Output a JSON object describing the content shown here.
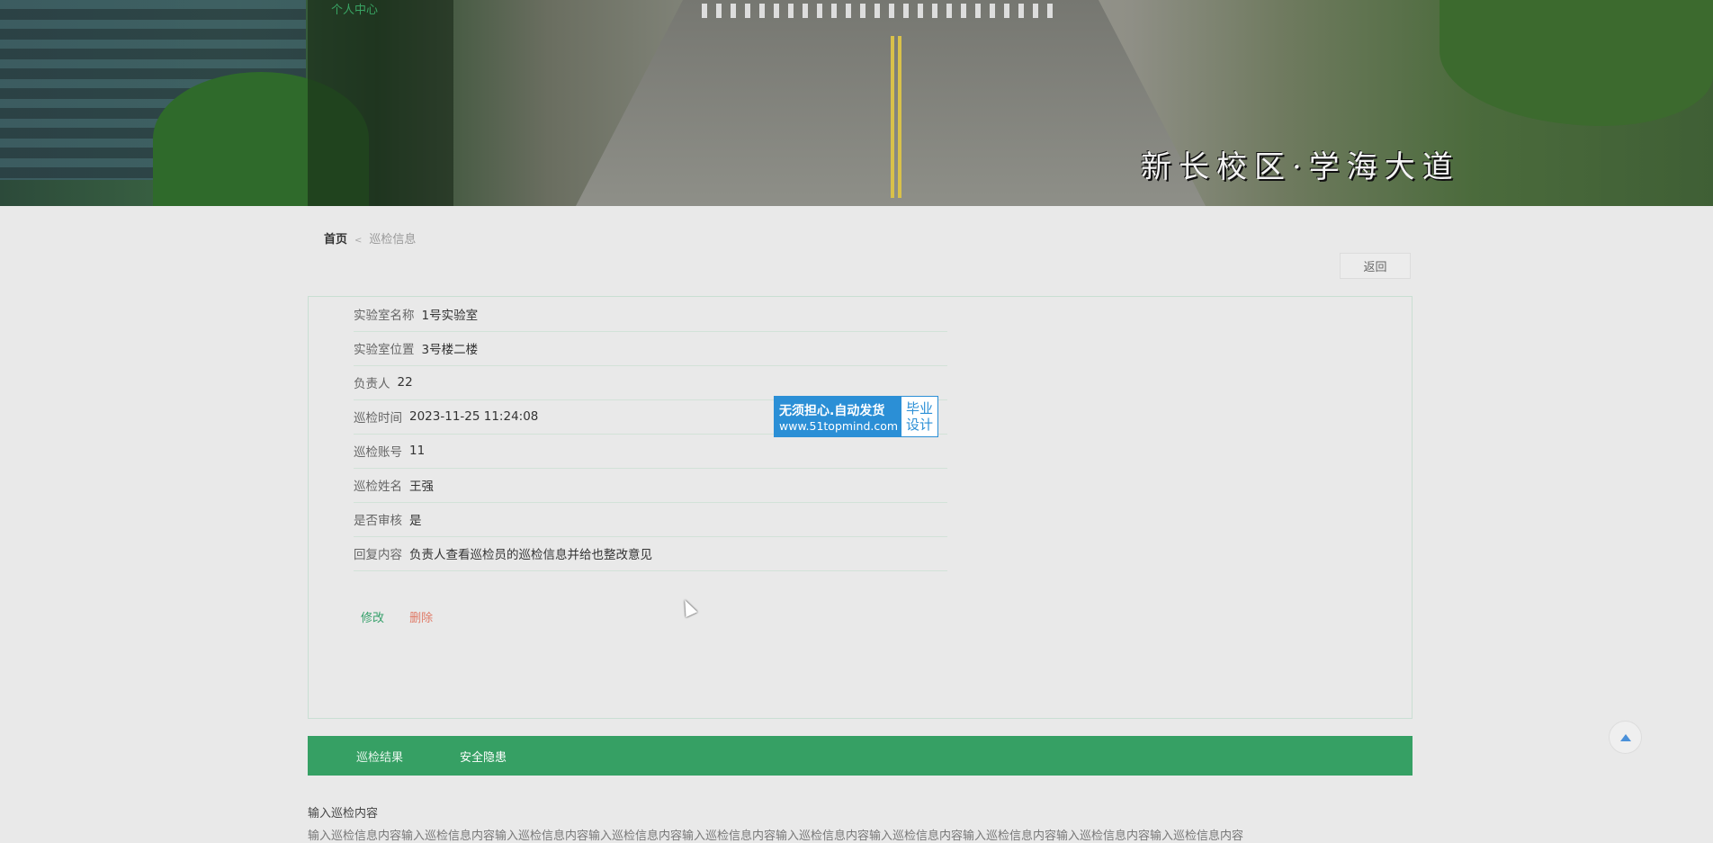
{
  "header": {
    "nav_link": "个人中心",
    "banner_caption": "新长校区·学海大道"
  },
  "breadcrumb": {
    "home": "首页",
    "separator": "<",
    "current": "巡检信息"
  },
  "back_button": "返回",
  "details": [
    {
      "label": "实验室名称",
      "value": "1号实验室"
    },
    {
      "label": "实验室位置",
      "value": "3号楼二楼"
    },
    {
      "label": "负责人",
      "value": "22"
    },
    {
      "label": "巡检时间",
      "value": "2023-11-25 11:24:08"
    },
    {
      "label": "巡检账号",
      "value": "11"
    },
    {
      "label": "巡检姓名",
      "value": "王强"
    },
    {
      "label": "是否审核",
      "value": "是"
    },
    {
      "label": "回复内容",
      "value": "负责人查看巡检员的巡检信息并给也整改意见"
    }
  ],
  "actions": {
    "edit": "修改",
    "delete": "删除"
  },
  "watermark": {
    "line1": "无须担心.自动发货",
    "line2": "www.51topmind.com",
    "right1": "毕业",
    "right2": "设计"
  },
  "tabs": {
    "tab1": "巡检结果",
    "tab2": "安全隐患"
  },
  "content": {
    "label": "输入巡检内容",
    "text": "输入巡检信息内容输入巡检信息内容输入巡检信息内容输入巡检信息内容输入巡检信息内容输入巡检信息内容输入巡检信息内容输入巡检信息内容输入巡检信息内容输入巡检信息内容"
  },
  "colors": {
    "accent": "#36a064",
    "danger": "#e07a67",
    "watermark": "#2b8fd6"
  }
}
